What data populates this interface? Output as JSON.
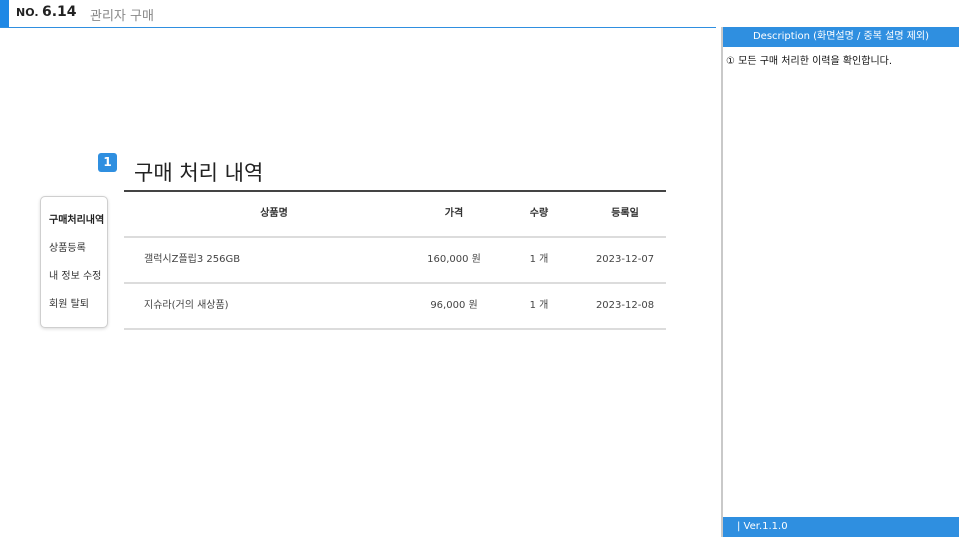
{
  "header": {
    "no_label": "NO.",
    "number": "6.14",
    "title": "관리자 구매"
  },
  "section": {
    "badge": "1",
    "title": "구매 처리 내역"
  },
  "side_menu": {
    "items": [
      {
        "label": "구매처리내역",
        "active": true
      },
      {
        "label": "상품등록",
        "active": false
      },
      {
        "label": "내 정보 수정",
        "active": false
      },
      {
        "label": "회원 탈퇴",
        "active": false
      }
    ]
  },
  "table": {
    "headers": {
      "name": "상품명",
      "price": "가격",
      "qty": "수량",
      "date": "등록일"
    },
    "rows": [
      {
        "name": "갤럭시Z플립3 256GB",
        "price": "160,000 원",
        "qty": "1 개",
        "date": "2023-12-07"
      },
      {
        "name": "지슈라(거의 새상품)",
        "price": "96,000 원",
        "qty": "1 개",
        "date": "2023-12-08"
      }
    ]
  },
  "description": {
    "header": "Description (화면설명 / 중복 설명 제외)",
    "text": "① 모든 구매 처리한 이력을 확인합니다.",
    "version": "| Ver.1.1.0"
  },
  "colors": {
    "accent": "#2f8fe0",
    "header_accent": "#1e88e5"
  }
}
